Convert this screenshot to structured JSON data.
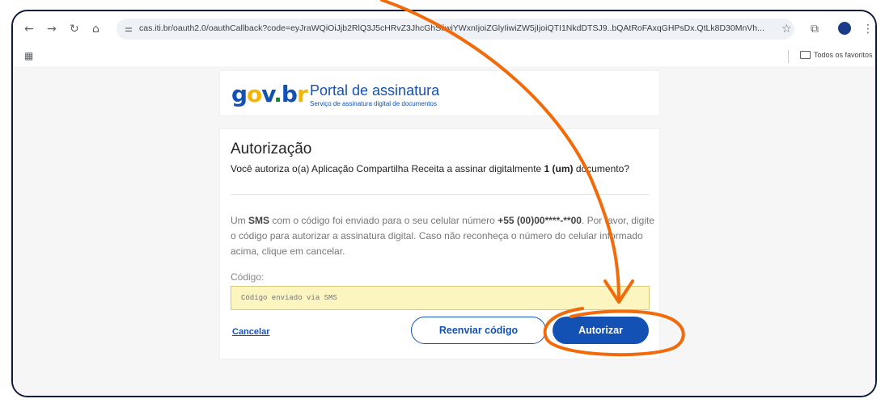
{
  "browser": {
    "url": "cas.iti.br/oauth2.0/oauthCallback?code=eyJraWQiOiJjb2RlQ3J5cHRvZ3JhcGhSiiwiYWxnIjoiZGlyIiwiZW5jIjoiQTI1NkdDTSJ9..bQAtRoFAxqGHPsDx.QtLk8D30MnVh...",
    "bookmarks_label": "Todos os favoritos",
    "icons": [
      "back-icon",
      "forward-icon",
      "reload-icon",
      "home-icon",
      "tune-icon",
      "star-icon",
      "extensions-icon",
      "profile-icon",
      "menu-icon",
      "apps-icon",
      "folder-icon"
    ]
  },
  "header": {
    "logo": "gov.br",
    "title": "Portal de assinatura",
    "subtitle": "Serviço de assinatura digital de documentos"
  },
  "authorization": {
    "title": "Autorização",
    "question_prefix": "Você autoriza o(a) Aplicação Compartilha Receita a assinar digitalmente ",
    "question_bold": "1 (um)",
    "question_suffix": " documento?",
    "sms_prefix": "Um ",
    "sms_bold": "SMS",
    "sms_mid": " com o código foi enviado para o seu celular número ",
    "sms_phone": "+55 (00)00****-**00",
    "sms_suffix": ". Por favor, digite o código para autorizar a assinatura digital. Caso não reconheça o número do celular informado acima, clique em cancelar.",
    "code_label": "Código:",
    "code_placeholder": "Código enviado via SMS",
    "cancel_label": "Cancelar",
    "resend_label": "Reenviar código",
    "authorize_label": "Autorizar"
  },
  "colors": {
    "gov_blue": "#1351b4",
    "annotation_orange": "#f26b0a",
    "input_yellow": "#fdf5bf"
  }
}
